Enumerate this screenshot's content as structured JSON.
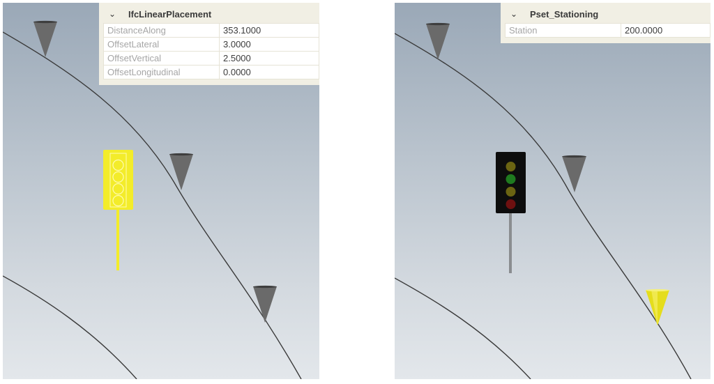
{
  "left_view": {
    "property_panel": {
      "title": "IfcLinearPlacement",
      "expanded_icon": "chevron-down-icon",
      "rows": [
        {
          "key": "DistanceAlong",
          "value": "353.1000"
        },
        {
          "key": "OffsetLateral",
          "value": "3.0000"
        },
        {
          "key": "OffsetVertical",
          "value": "2.5000"
        },
        {
          "key": "OffsetLongitudinal",
          "value": "0.0000"
        }
      ]
    },
    "objects": {
      "signal_state": "selected",
      "signal_color": "#f3ec2a",
      "cone_color": "#5f5f5f",
      "cone_count": 3
    }
  },
  "right_view": {
    "property_panel": {
      "title": "Pset_Stationing",
      "expanded_icon": "chevron-down-icon",
      "rows": [
        {
          "key": "Station",
          "value": "200.0000"
        }
      ]
    },
    "objects": {
      "signal_state": "normal",
      "signal_lamps": [
        "#6b6412",
        "#1f7a1f",
        "#6b6412",
        "#6e1010"
      ],
      "cone_color": "#5f5f5f",
      "highlighted_cone_color": "#f3ec2a",
      "cone_count": 3
    }
  },
  "colors": {
    "panel_bg": "#f1efe4",
    "alignment_line": "#3a3a3a"
  }
}
